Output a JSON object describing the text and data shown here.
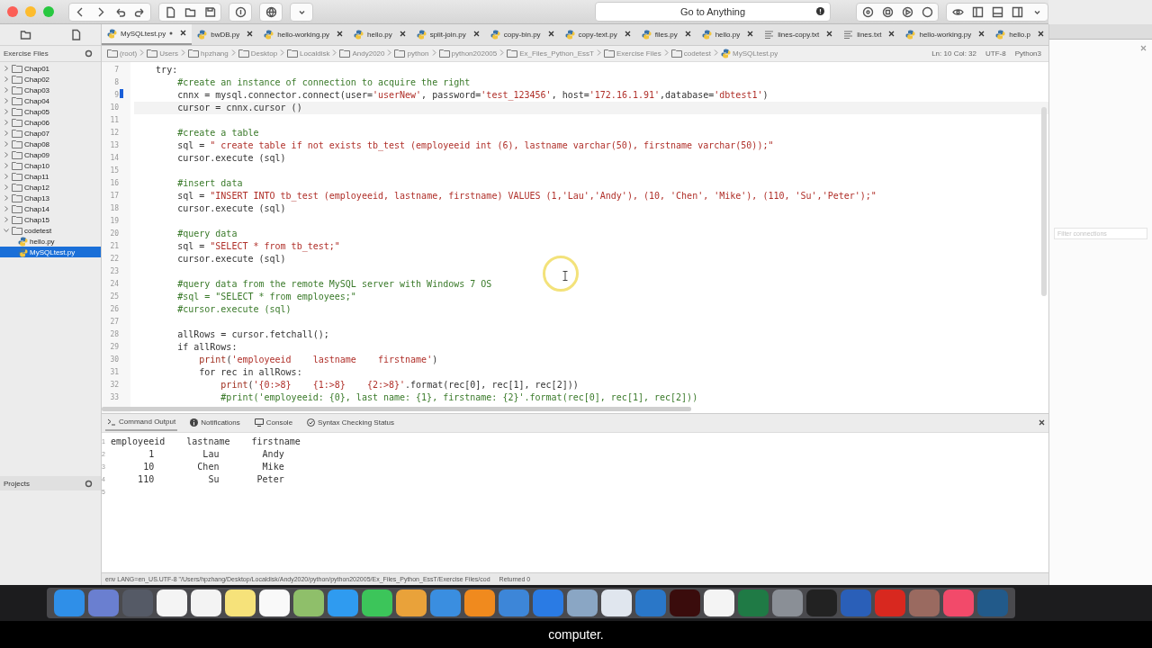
{
  "toolbar": {
    "goto": "Go to Anything"
  },
  "tabs": [
    {
      "label": "MySQLtest.py",
      "kind": "python",
      "selected": true,
      "modified": true
    },
    {
      "label": "bwDB.py",
      "kind": "python",
      "selected": false,
      "modified": false
    },
    {
      "label": "hello-working.py",
      "kind": "python",
      "selected": false,
      "modified": false
    },
    {
      "label": "hello.py",
      "kind": "python",
      "selected": false,
      "modified": false
    },
    {
      "label": "split-join.py",
      "kind": "python",
      "selected": false,
      "modified": false
    },
    {
      "label": "copy-bin.py",
      "kind": "python",
      "selected": false,
      "modified": false
    },
    {
      "label": "copy-text.py",
      "kind": "python",
      "selected": false,
      "modified": false
    },
    {
      "label": "files.py",
      "kind": "python",
      "selected": false,
      "modified": false
    },
    {
      "label": "hello.py",
      "kind": "python",
      "selected": false,
      "modified": false
    },
    {
      "label": "lines-copy.txt",
      "kind": "text",
      "selected": false,
      "modified": false
    },
    {
      "label": "lines.txt",
      "kind": "text",
      "selected": false,
      "modified": false
    },
    {
      "label": "hello-working.py",
      "kind": "python",
      "selected": false,
      "modified": false
    },
    {
      "label": "hello.p",
      "kind": "python",
      "selected": false,
      "modified": false
    }
  ],
  "sidebar": {
    "title": "Exercise Files",
    "projects": "Projects",
    "items": [
      {
        "label": "Chap01",
        "kind": "folder",
        "expanded": false,
        "selected": false
      },
      {
        "label": "Chap02",
        "kind": "folder",
        "expanded": false,
        "selected": false
      },
      {
        "label": "Chap03",
        "kind": "folder",
        "expanded": false,
        "selected": false
      },
      {
        "label": "Chap04",
        "kind": "folder",
        "expanded": false,
        "selected": false
      },
      {
        "label": "Chap05",
        "kind": "folder",
        "expanded": false,
        "selected": false
      },
      {
        "label": "Chap06",
        "kind": "folder",
        "expanded": false,
        "selected": false
      },
      {
        "label": "Chap07",
        "kind": "folder",
        "expanded": false,
        "selected": false
      },
      {
        "label": "Chap08",
        "kind": "folder",
        "expanded": false,
        "selected": false
      },
      {
        "label": "Chap09",
        "kind": "folder",
        "expanded": false,
        "selected": false
      },
      {
        "label": "Chap10",
        "kind": "folder",
        "expanded": false,
        "selected": false
      },
      {
        "label": "Chap11",
        "kind": "folder",
        "expanded": false,
        "selected": false
      },
      {
        "label": "Chap12",
        "kind": "folder",
        "expanded": false,
        "selected": false
      },
      {
        "label": "Chap13",
        "kind": "folder",
        "expanded": false,
        "selected": false
      },
      {
        "label": "Chap14",
        "kind": "folder",
        "expanded": false,
        "selected": false
      },
      {
        "label": "Chap15",
        "kind": "folder",
        "expanded": false,
        "selected": false
      },
      {
        "label": "codetest",
        "kind": "folder",
        "expanded": true,
        "selected": false,
        "children": [
          {
            "label": "hello.py",
            "kind": "file",
            "selected": false
          },
          {
            "label": "MySQLtest.py",
            "kind": "file",
            "selected": true
          }
        ]
      }
    ]
  },
  "breadcrumb": [
    "(root)",
    "Users",
    "hpzhang",
    "Desktop",
    "Localdisk",
    "Andy2020",
    "python",
    "python202005",
    "Ex_Files_Python_EssT",
    "Exercise Files",
    "codetest",
    "MySQLtest.py"
  ],
  "editor_status": {
    "position": "Ln: 10 Col: 32",
    "encoding": "UTF-8",
    "language": "Python3"
  },
  "code": [
    {
      "number": "7",
      "current": false,
      "segments": [
        {
          "kind": "plain",
          "text": "    try:"
        }
      ]
    },
    {
      "number": "8",
      "current": false,
      "segments": [
        {
          "kind": "comment",
          "text": "        #create an instance of connection to acquire the right"
        }
      ]
    },
    {
      "number": "9",
      "current": false,
      "segments": [
        {
          "kind": "plain",
          "text": "        cnnx = mysql.connector.connect(user="
        },
        {
          "kind": "string",
          "text": "'userNew'"
        },
        {
          "kind": "plain",
          "text": ", password="
        },
        {
          "kind": "string",
          "text": "'test_123456'"
        },
        {
          "kind": "plain",
          "text": ", host="
        },
        {
          "kind": "string",
          "text": "'172.16.1.91'"
        },
        {
          "kind": "plain",
          "text": ",database="
        },
        {
          "kind": "string",
          "text": "'dbtest1'"
        },
        {
          "kind": "plain",
          "text": ")"
        }
      ]
    },
    {
      "number": "10",
      "current": true,
      "segments": [
        {
          "kind": "plain",
          "text": "        cursor = cnnx.cursor ()"
        }
      ]
    },
    {
      "number": "11",
      "current": false
    },
    {
      "number": "12",
      "current": false,
      "segments": [
        {
          "kind": "comment",
          "text": "        #create a table"
        }
      ]
    },
    {
      "number": "13",
      "current": false,
      "segments": [
        {
          "kind": "plain",
          "text": "        sql = "
        },
        {
          "kind": "string",
          "text": "\" create table if not exists tb_test (employeeid int (6), lastname varchar(50), firstname varchar(50));\""
        }
      ]
    },
    {
      "number": "14",
      "current": false,
      "segments": [
        {
          "kind": "plain",
          "text": "        cursor.execute (sql)"
        }
      ]
    },
    {
      "number": "15",
      "current": false
    },
    {
      "number": "16",
      "current": false,
      "segments": [
        {
          "kind": "comment",
          "text": "        #insert data"
        }
      ]
    },
    {
      "number": "17",
      "current": false,
      "segments": [
        {
          "kind": "plain",
          "text": "        sql = "
        },
        {
          "kind": "string",
          "text": "\"INSERT INTO tb_test (employeeid, lastname, firstname) VALUES (1,'Lau','Andy'), (10, 'Chen', 'Mike'), (110, 'Su','Peter');\""
        }
      ]
    },
    {
      "number": "18",
      "current": false,
      "segments": [
        {
          "kind": "plain",
          "text": "        cursor.execute (sql)"
        }
      ]
    },
    {
      "number": "19",
      "current": false
    },
    {
      "number": "20",
      "current": false,
      "segments": [
        {
          "kind": "comment",
          "text": "        #query data"
        }
      ]
    },
    {
      "number": "21",
      "current": false,
      "segments": [
        {
          "kind": "plain",
          "text": "        sql = "
        },
        {
          "kind": "string",
          "text": "\"SELECT * from tb_test;\""
        }
      ]
    },
    {
      "number": "22",
      "current": false,
      "segments": [
        {
          "kind": "plain",
          "text": "        cursor.execute (sql)"
        }
      ]
    },
    {
      "number": "23",
      "current": false
    },
    {
      "number": "24",
      "current": false,
      "segments": [
        {
          "kind": "comment",
          "text": "        #query data from the remote MySQL server with Windows 7 OS"
        }
      ]
    },
    {
      "number": "25",
      "current": false,
      "segments": [
        {
          "kind": "comment",
          "text": "        #sql = \"SELECT * from employees;\""
        }
      ]
    },
    {
      "number": "26",
      "current": false,
      "segments": [
        {
          "kind": "comment",
          "text": "        #cursor.execute (sql)"
        }
      ]
    },
    {
      "number": "27",
      "current": false
    },
    {
      "number": "28",
      "current": false,
      "segments": [
        {
          "kind": "plain",
          "text": "        allRows = cursor.fetchall();"
        }
      ]
    },
    {
      "number": "29",
      "current": false,
      "segments": [
        {
          "kind": "plain",
          "text": "        if allRows:"
        }
      ]
    },
    {
      "number": "30",
      "current": false,
      "segments": [
        {
          "kind": "builtin",
          "text": "            print"
        },
        {
          "kind": "plain",
          "text": "("
        },
        {
          "kind": "string",
          "text": "'employeeid    lastname    firstname'"
        },
        {
          "kind": "plain",
          "text": ")"
        }
      ]
    },
    {
      "number": "31",
      "current": false,
      "segments": [
        {
          "kind": "plain",
          "text": "            for rec in allRows:"
        }
      ]
    },
    {
      "number": "32",
      "current": false,
      "segments": [
        {
          "kind": "builtin",
          "text": "                print"
        },
        {
          "kind": "plain",
          "text": "("
        },
        {
          "kind": "string",
          "text": "'{0:>8}    {1:>8}    {2:>8}'"
        },
        {
          "kind": "plain",
          "text": ".format(rec[0], rec[1], rec[2]))"
        }
      ]
    },
    {
      "number": "33",
      "current": false,
      "segments": [
        {
          "kind": "comment",
          "text": "                #print('employeeid: {0}, last name: {1}, firstname: {2}'.format(rec[0], rec[1], rec[2]))"
        }
      ]
    }
  ],
  "bottom_tabs": [
    {
      "label": "Command Output",
      "kind": "terminal",
      "selected": true
    },
    {
      "label": "Notifications",
      "kind": "info",
      "selected": false
    },
    {
      "label": "Console",
      "kind": "monitor",
      "selected": false
    },
    {
      "label": "Syntax Checking Status",
      "kind": "syntax",
      "selected": false
    }
  ],
  "output": [
    {
      "number": "1",
      "text": "employeeid    lastname    firstname"
    },
    {
      "number": "2",
      "text": "       1         Lau        Andy"
    },
    {
      "number": "3",
      "text": "      10        Chen        Mike"
    },
    {
      "number": "4",
      "text": "     110          Su       Peter"
    },
    {
      "number": "5"
    }
  ],
  "status_bar": {
    "command": "env LANG=en_US.UTF-8 \"/Users/hpzhang/Desktop/Localdisk/Andy2020/python/python202005/Ex_Files_Python_EssT/Exercise Files/cod",
    "result": "Returned 0"
  },
  "side_window": {
    "placeholder": "Filter connections"
  },
  "caption": "computer."
}
